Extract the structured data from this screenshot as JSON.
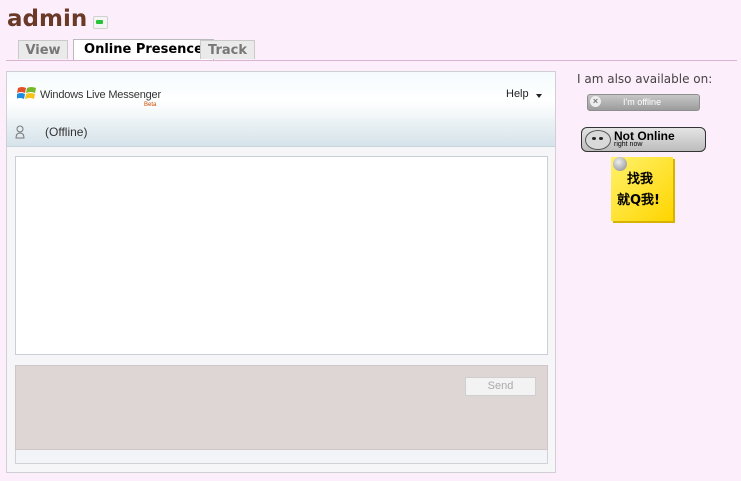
{
  "header": {
    "title": "admin",
    "status_icon": "online-status-icon",
    "status_color": "#27c235"
  },
  "tabs": [
    {
      "label": "View",
      "active": false
    },
    {
      "label": "Online Presence",
      "active": true
    },
    {
      "label": "Track",
      "active": false
    }
  ],
  "messenger": {
    "brand": "Windows Live Messenger",
    "beta": "Beta",
    "help_label": "Help",
    "user_status": "(Offline)",
    "send_label": "Send"
  },
  "sidebar": {
    "available_label": "I am also available on:",
    "badge1_label": "I'm offline",
    "badge2_title": "Not Online",
    "badge2_sub": "right now",
    "sticky_line1": "找我",
    "sticky_line2": "就Q我!"
  },
  "colors": {
    "background": "#fdeefb",
    "title": "#6a3a28",
    "compose_bg": "#ded5d5"
  }
}
